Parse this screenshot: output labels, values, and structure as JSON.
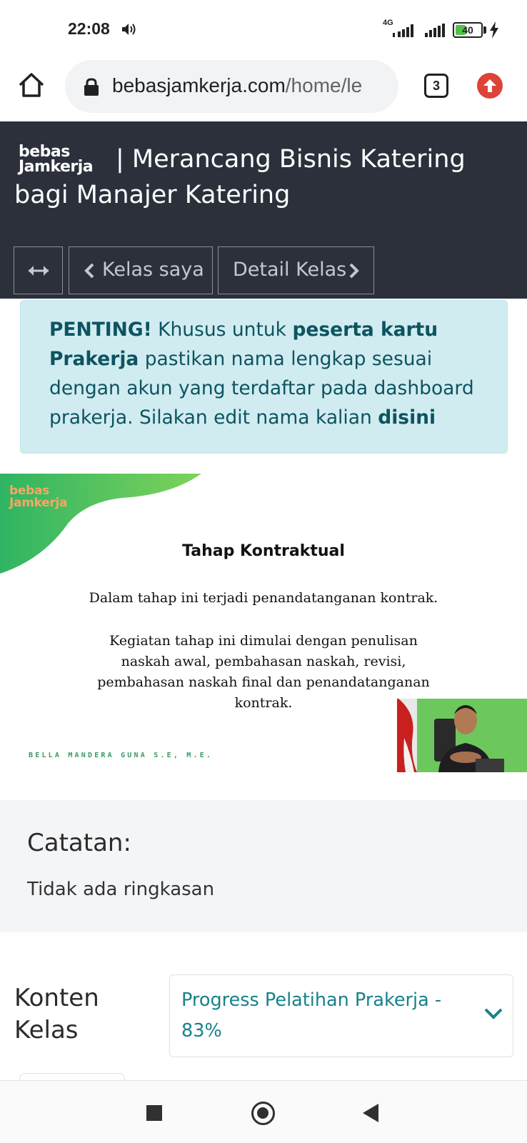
{
  "status_bar": {
    "time": "22:08",
    "network_type": "4G",
    "battery_level": "40",
    "icons": [
      "speaker-icon",
      "signal-icon",
      "battery-icon",
      "charging-icon"
    ]
  },
  "browser": {
    "url_domain": "bebasjamkerja.com",
    "url_path": "/home/le",
    "tab_count": "3",
    "icons": [
      "home-icon",
      "lock-icon",
      "update-icon"
    ],
    "update_color": "#db4437"
  },
  "header": {
    "logo_line1": "bebas",
    "logo_line2": "Jamkerja",
    "title": "| Merancang Bisnis Katering bagi Manajer Katering",
    "back_label": "Kelas saya",
    "next_label": "Detail Kelas",
    "background": "#2b303b"
  },
  "alert": {
    "strong1": "PENTING!",
    "text1": " Khusus untuk ",
    "strong2": "peserta kartu Prakerja",
    "text2": " pastikan nama lengkap sesuai dengan akun yang terdaftar pada dashboard prakerja. Silakan edit nama kalian ",
    "link": "disini",
    "background": "#d1ecf1",
    "color": "#0c5460"
  },
  "slide": {
    "logo_line1": "bebas",
    "logo_line2": "Jamkerja",
    "title": "Tahap Kontraktual",
    "paragraph1": "Dalam tahap ini terjadi penandatanganan kontrak.",
    "paragraph2": "Kegiatan tahap ini dimulai dengan penulisan naskah awal, pembahasan naskah, revisi, pembahasan naskah final dan penandatanganan kontrak.",
    "presenter": "BELLA MANDERA GUNA S.E, M.E.",
    "accent": "#4cc25a"
  },
  "notes": {
    "title": "Catatan:",
    "body": "Tidak ada ringkasan"
  },
  "course_content": {
    "title": "Konten Kelas",
    "progress_label": "Progress Pelatihan Prakerja - 83%",
    "progress_value": 83,
    "accent": "#17828a"
  },
  "nav_bar": {
    "icons": [
      "recents-icon",
      "home-circle-icon",
      "back-icon"
    ]
  }
}
